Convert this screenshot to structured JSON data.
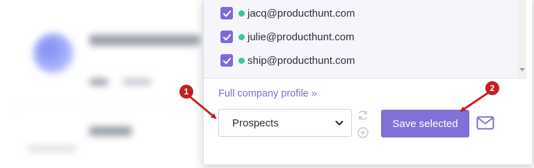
{
  "emails": [
    {
      "address": "jacq@producthunt.com",
      "checked": true,
      "status": "online"
    },
    {
      "address": "julie@producthunt.com",
      "checked": true,
      "status": "online"
    },
    {
      "address": "ship@producthunt.com",
      "checked": true,
      "status": "online"
    }
  ],
  "profile_link": "Full company profile »",
  "list_select": {
    "selected": "Prospects"
  },
  "save_button": "Save selected",
  "icons": [
    "check-icon",
    "status-dot-icon",
    "chevron-down-icon",
    "refresh-icon",
    "add-circle-icon",
    "mail-icon"
  ],
  "annotations": [
    {
      "number": "1",
      "target": "list-select"
    },
    {
      "number": "2",
      "target": "save-button"
    }
  ],
  "colors": {
    "accent": "#7c6bd6",
    "button": "#8171d8",
    "status_online": "#3ec990",
    "annotation": "#c51f1f"
  }
}
